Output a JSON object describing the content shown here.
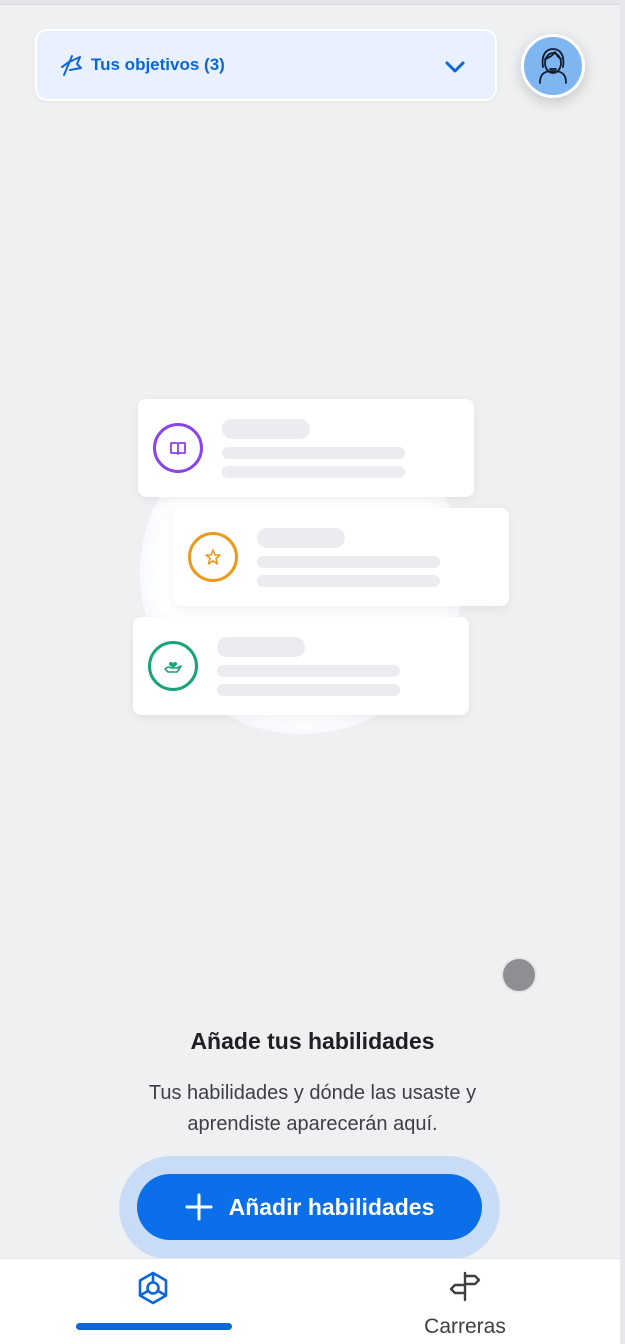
{
  "header": {
    "goals_label": "Tus objetivos (3)",
    "goals_icon": "flag-icon",
    "expand_icon": "chevron-down-icon",
    "avatar_icon": "user-avatar-icon"
  },
  "illustration": {
    "cards": [
      {
        "icon": "book-icon",
        "color": "#8b45e6"
      },
      {
        "icon": "star-icon",
        "color": "#eb9a1e"
      },
      {
        "icon": "hand-heart-icon",
        "color": "#1aa37a"
      }
    ]
  },
  "empty_state": {
    "title": "Añade tus habilidades",
    "description": "Tus habilidades y dónde las usaste y aprendiste aparecerán aquí.",
    "cta_label": "Añadir habilidades",
    "cta_icon": "plus-icon"
  },
  "bottom_nav": {
    "items": [
      {
        "label": "",
        "icon": "skills-hub-icon",
        "active": true
      },
      {
        "label": "Carreras",
        "icon": "signpost-icon",
        "active": false
      }
    ]
  },
  "colors": {
    "accent": "#0a66d9",
    "cta": "#0a6fe8",
    "background": "#eef0f2"
  }
}
